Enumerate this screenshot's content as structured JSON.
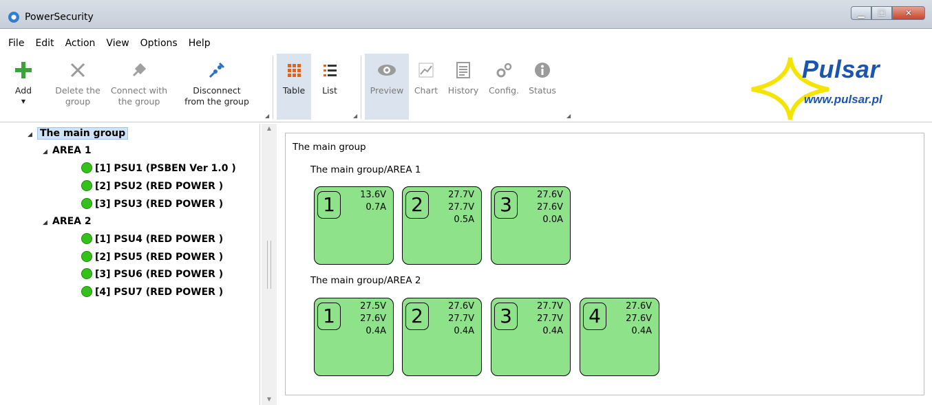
{
  "window": {
    "title": "PowerSecurity",
    "icon": "app-logo-icon",
    "buttons": {
      "minimize": "minimize-icon",
      "maximize": "maximize-icon",
      "close": "close-icon"
    }
  },
  "menu": [
    "File",
    "Edit",
    "Action",
    "View",
    "Options",
    "Help"
  ],
  "ribbon": {
    "add": {
      "label": "Add",
      "icon": "plus-icon",
      "color": "#3aa33a"
    },
    "delete": {
      "line1": "Delete the",
      "line2": "group",
      "icon": "x-icon"
    },
    "connect": {
      "line1": "Connect with",
      "line2": "the group",
      "icon": "plug-icon"
    },
    "disconnect": {
      "line1": "Disconnect",
      "line2": "from the group",
      "icon": "unplug-icon"
    },
    "table": {
      "label": "Table",
      "icon": "grid-icon",
      "accent": "#e0641e"
    },
    "list": {
      "label": "List",
      "icon": "list-icon"
    },
    "preview": {
      "label": "Preview",
      "icon": "eye-icon"
    },
    "chart": {
      "label": "Chart",
      "icon": "chart-icon"
    },
    "history": {
      "label": "History",
      "icon": "history-icon"
    },
    "config": {
      "label": "Config.",
      "icon": "gears-icon"
    },
    "status": {
      "label": "Status",
      "icon": "info-icon"
    }
  },
  "logo": {
    "brand": "Pulsar",
    "url": "www.pulsar.pl",
    "brand_color": "#1a56b0",
    "star_color": "#f5e300"
  },
  "tree": {
    "root": "The main group",
    "areas": [
      {
        "label": "AREA 1",
        "items": [
          "[1] PSU1 (PSBEN Ver 1.0 )",
          "[2] PSU2 (RED POWER )",
          "[3] PSU3 (RED POWER )"
        ]
      },
      {
        "label": "AREA 2",
        "items": [
          "[1] PSU4 (RED POWER )",
          "[2] PSU5 (RED POWER )",
          "[3] PSU6 (RED POWER )",
          "[4] PSU7 (RED POWER )"
        ]
      }
    ],
    "status_color": "#34c21a"
  },
  "main": {
    "title": "The main group",
    "areas": [
      {
        "title": "The main group/AREA 1",
        "cards": [
          {
            "num": "1",
            "v1": "13.6V",
            "v2": "0.7A",
            "v3": ""
          },
          {
            "num": "2",
            "v1": "27.7V",
            "v2": "27.7V",
            "v3": "0.5A"
          },
          {
            "num": "3",
            "v1": "27.6V",
            "v2": "27.6V",
            "v3": "0.0A"
          }
        ]
      },
      {
        "title": "The main group/AREA 2",
        "cards": [
          {
            "num": "1",
            "v1": "27.5V",
            "v2": "27.6V",
            "v3": "0.4A"
          },
          {
            "num": "2",
            "v1": "27.6V",
            "v2": "27.7V",
            "v3": "0.4A"
          },
          {
            "num": "3",
            "v1": "27.7V",
            "v2": "27.7V",
            "v3": "0.4A"
          },
          {
            "num": "4",
            "v1": "27.6V",
            "v2": "27.6V",
            "v3": "0.4A"
          }
        ]
      }
    ],
    "card_color": "#8ee28a"
  }
}
